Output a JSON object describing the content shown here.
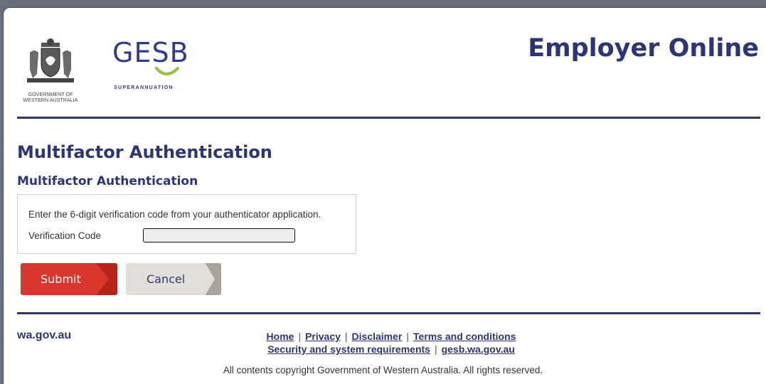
{
  "header": {
    "gov_line1": "GOVERNMENT OF",
    "gov_line2": "WESTERN AUSTRALIA",
    "gesb_logo_text": "GESB",
    "gesb_logo_sub": "SUPERANNUATION",
    "app_title": "Employer Online"
  },
  "main": {
    "page_heading": "Multifactor Authentication",
    "section_heading": "Multifactor Authentication",
    "instruction": "Enter the 6-digit verification code from your authenticator application.",
    "code_label": "Verification Code",
    "code_value": "",
    "submit_label": "Submit",
    "cancel_label": "Cancel"
  },
  "footer": {
    "site": "wa.gov.au",
    "links_row1": [
      "Home",
      "Privacy",
      "Disclaimer",
      "Terms and conditions"
    ],
    "links_row2": [
      "Security and system requirements",
      "gesb.wa.gov.au"
    ],
    "copyright": "All contents copyright Government of Western Australia. All rights reserved."
  },
  "colors": {
    "brand_navy": "#2b3578",
    "submit_red": "#d9362e",
    "cancel_grey": "#e2dfdb",
    "gesb_green": "#8bc53f"
  }
}
